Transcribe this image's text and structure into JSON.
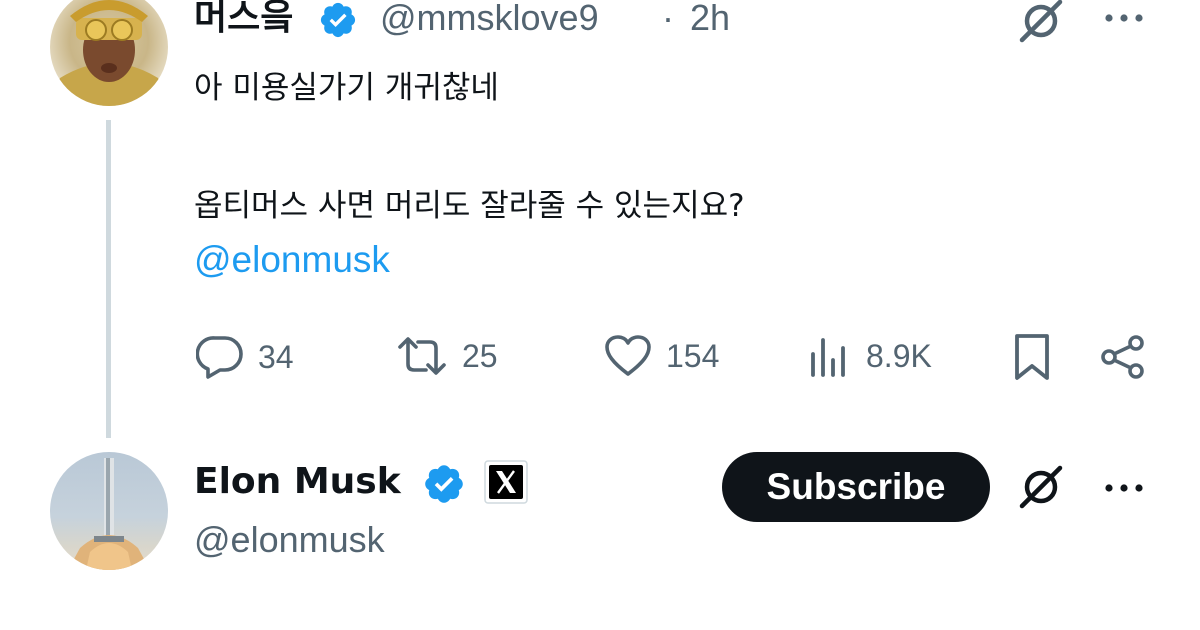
{
  "reply_tweet": {
    "display_name": "머스읔",
    "handle": "@mmsklove9",
    "separator": "·",
    "timestamp": "2h",
    "text_line1": "아 미용실가기 개귀찮네",
    "text_line2": "옵티머스 사면 머리도 잘라줄 수 있는지요?",
    "mention": "@elonmusk",
    "actions": {
      "replies": "34",
      "reposts": "25",
      "likes": "154",
      "views": "8.9K"
    }
  },
  "author_card": {
    "display_name": "Elon Musk",
    "handle": "@elonmusk",
    "subscribe_label": "Subscribe"
  },
  "colors": {
    "verified_badge": "#1d9bf0",
    "mention": "#1d9bf0",
    "muted_text": "#536471",
    "primary_text": "#0f1419",
    "subscribe_bg": "#0f1419"
  },
  "icons": [
    "verified-badge-icon",
    "grok-icon",
    "more-icon",
    "reply-icon",
    "repost-icon",
    "like-icon",
    "views-icon",
    "bookmark-icon",
    "share-icon",
    "x-logo-icon"
  ]
}
